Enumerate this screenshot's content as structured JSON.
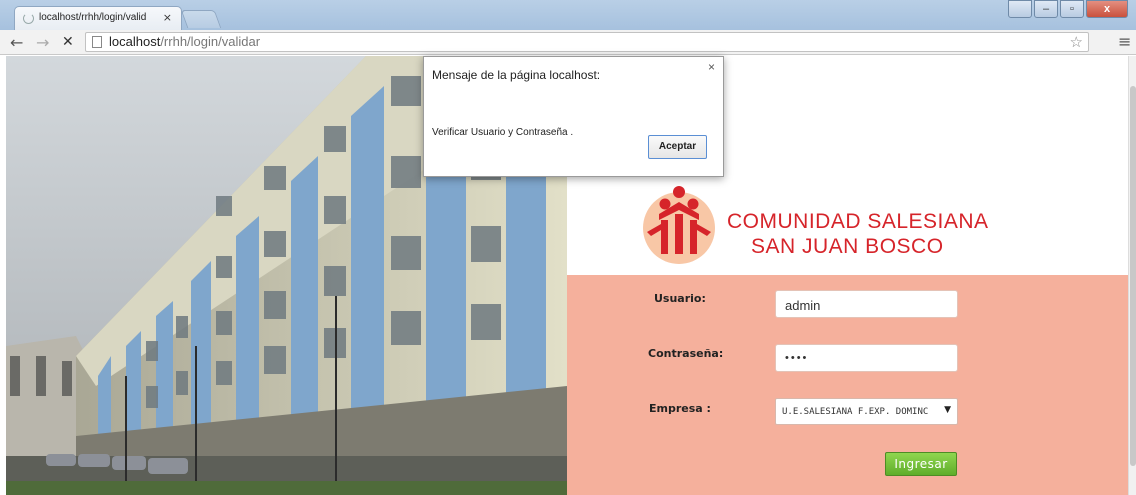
{
  "browser": {
    "tab_title": "localhost/rrhh/login/valid",
    "tab_close": "×",
    "url_host": "localhost",
    "url_path": "/rrhh/login/validar",
    "back_icon": "←",
    "forward_icon": "→",
    "stop_icon": "✕",
    "star_icon": "☆",
    "menu_icon": "≡",
    "window_minimize": "–",
    "window_restore": "▫",
    "window_close": "x"
  },
  "page": {
    "brand_line1": "COMUNIDAD SALESIANA",
    "brand_line2": "SAN JUAN BOSCO",
    "brand_color": "#d6242a",
    "form_background": "#f5b09c"
  },
  "form": {
    "usuario_label": "Usuario:",
    "usuario_value": "admin",
    "contrasena_label": "Contraseña:",
    "contrasena_value": "••••",
    "empresa_label": "Empresa :",
    "empresa_selected": "U.E.SALESIANA F.EXP. DOMINC",
    "submit_label": "Ingresar",
    "submit_color": "#6dbb35"
  },
  "dialog": {
    "title": "Mensaje de la página localhost:",
    "message": "Verificar Usuario y Contraseña .",
    "ok_label": "Aceptar",
    "close_icon": "×"
  }
}
